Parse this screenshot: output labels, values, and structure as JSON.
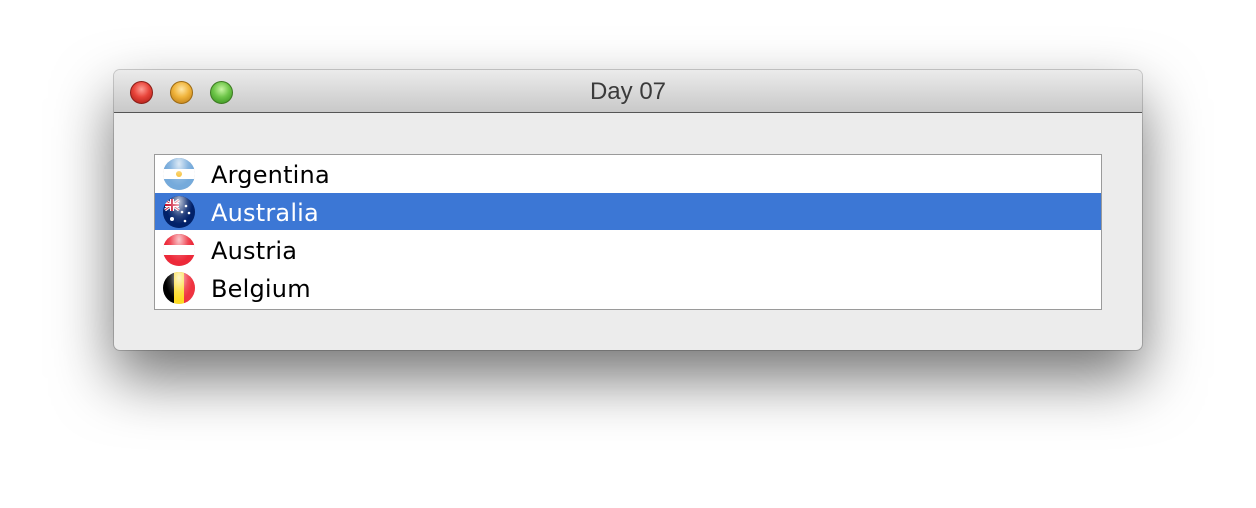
{
  "window": {
    "title": "Day 07"
  },
  "titlebar": {
    "buttons": [
      {
        "name": "close",
        "color": "#e8453b"
      },
      {
        "name": "minimize",
        "color": "#f0b43c"
      },
      {
        "name": "zoom",
        "color": "#6fc64a"
      }
    ]
  },
  "list": {
    "selected_index": 1,
    "selection_color": "#3c77d5",
    "items": [
      {
        "label": "Argentina",
        "icon": "argentina-flag-icon"
      },
      {
        "label": "Australia",
        "icon": "australia-flag-icon"
      },
      {
        "label": "Austria",
        "icon": "austria-flag-icon"
      },
      {
        "label": "Belgium",
        "icon": "belgium-flag-icon"
      }
    ]
  }
}
